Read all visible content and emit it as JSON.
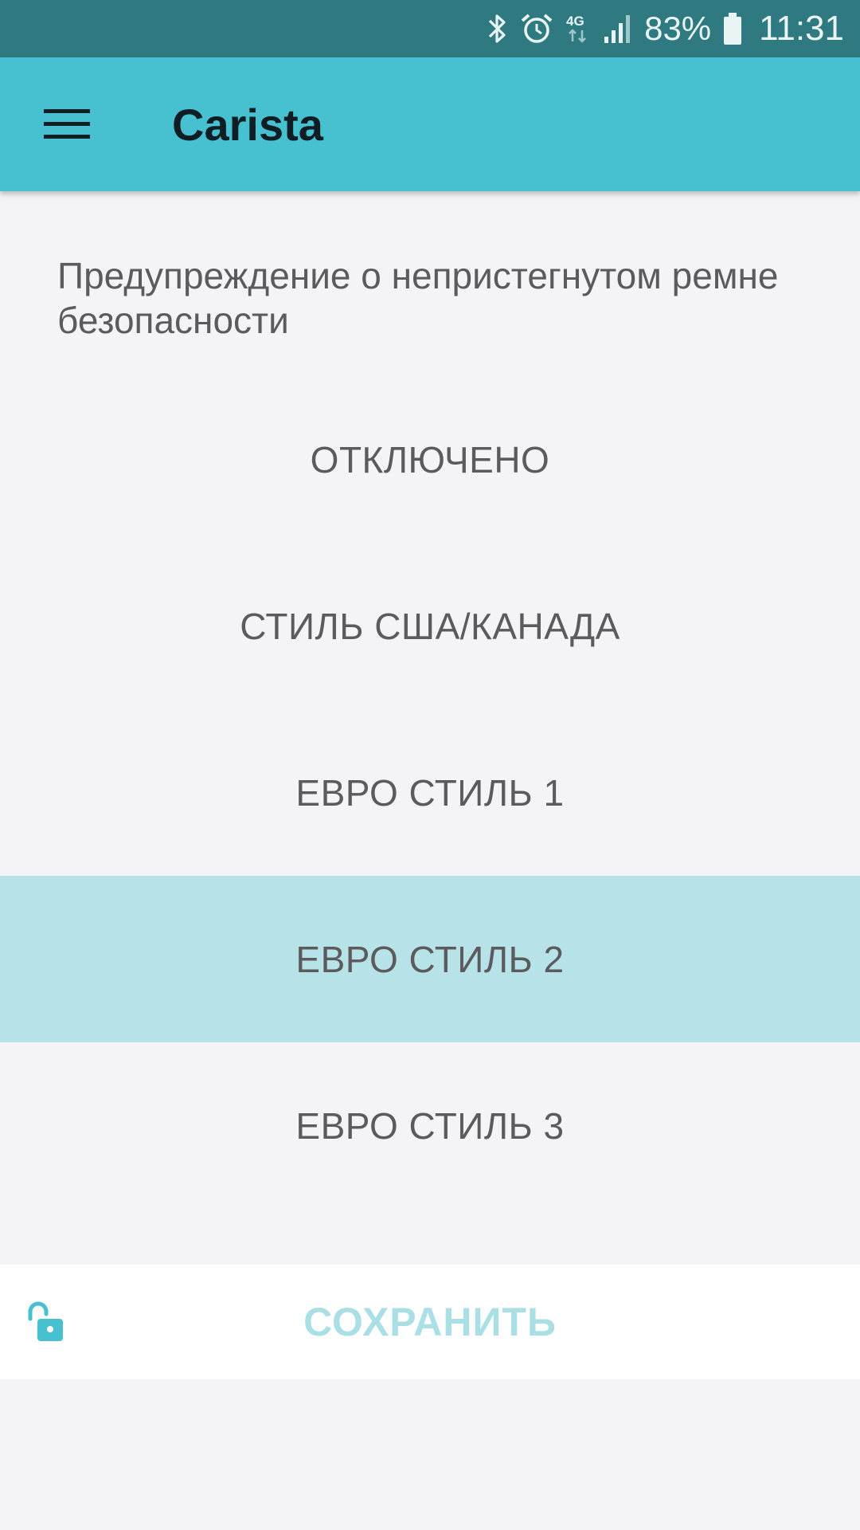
{
  "status_bar": {
    "icons": [
      "bluetooth-icon",
      "alarm-icon",
      "4g-icon",
      "signal-icon",
      "battery-icon"
    ],
    "network_label": "4G",
    "battery_percent": "83%",
    "time": "11:31"
  },
  "app_bar": {
    "menu_icon": "hamburger-menu-icon",
    "title": "Carista"
  },
  "setting": {
    "title": "Предупреждение о непристегнутом ремне безопасности"
  },
  "options": [
    {
      "label": "ОТКЛЮЧЕНО",
      "selected": false
    },
    {
      "label": "СТИЛЬ США/КАНАДА",
      "selected": false
    },
    {
      "label": "ЕВРО СТИЛЬ 1",
      "selected": false
    },
    {
      "label": "ЕВРО СТИЛЬ 2",
      "selected": true
    },
    {
      "label": "ЕВРО СТИЛЬ 3",
      "selected": false
    }
  ],
  "save_bar": {
    "lock_icon": "unlocked-padlock-icon",
    "save_label": "СОХРАНИТЬ"
  },
  "colors": {
    "status_bar": "#2f7a80",
    "app_bar": "#47c1d0",
    "selected_option": "#b6e2e8",
    "save_text": "#a9dfe5",
    "background": "#f4f4f7"
  }
}
